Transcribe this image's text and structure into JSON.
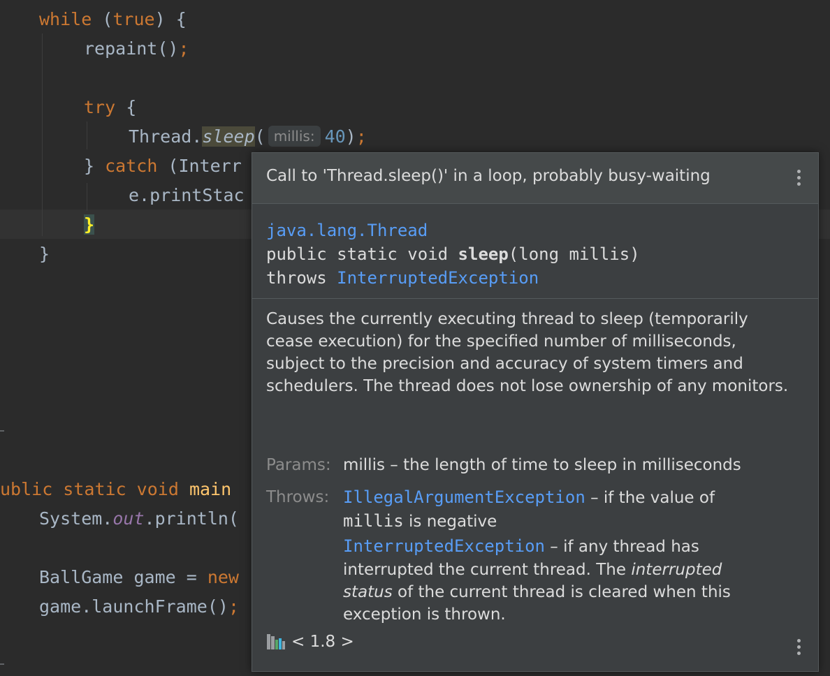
{
  "editor": {
    "lines": {
      "while_kw": "while",
      "while_rest": " (",
      "true_kw": "true",
      "while_tail": ") {",
      "repaint": "repaint()",
      "repaint_semi": ";",
      "try_kw": "try",
      "try_tail": " {",
      "thread_prefix": "Thread.",
      "sleep_method": "sleep",
      "sleep_open": "(",
      "param_hint": "millis:",
      "sleep_arg": "40",
      "sleep_close": ")",
      "sleep_semi": ";",
      "catch_open": "} ",
      "catch_kw": "catch",
      "catch_tail": " (Interr",
      "print_stack": "e.printStac",
      "inner_close_brace": "}",
      "outer_close_brace": "}",
      "main_prefix": "ublic static void ",
      "main_name": "main",
      "sysout_prefix": "System.",
      "sysout_field": "out",
      "sysout_tail": ".println(",
      "ballgame_decl": "BallGame game = ",
      "new_kw": "new",
      "launch_call": "game.launchFrame()",
      "launch_semi": ";"
    }
  },
  "popup": {
    "title": "Call to 'Thread.sleep()' in a loop, probably busy-waiting",
    "signature": {
      "class_path": "java.lang.Thread",
      "decl_prefix": "public static void ",
      "method_name": "sleep",
      "decl_suffix": "(long millis)",
      "throws_kw": "throws ",
      "throws_type": "InterruptedException"
    },
    "description": "Causes the currently executing thread to sleep (temporarily cease execution) for the specified number of milliseconds, subject to the precision and accuracy of system timers and schedulers. The thread does not lose ownership of any monitors.",
    "params_label": "Params:",
    "params_text": "millis – the length of time to sleep in milliseconds",
    "throws_label": "Throws:",
    "throws": [
      {
        "type": "IllegalArgumentException",
        "line1": " – if the value of",
        "code": "millis",
        "line2": " is negative"
      },
      {
        "type": "InterruptedException",
        "line1": " – if any thread has",
        "line2_pre": "interrupted the current thread. The ",
        "italic1": "interrupted",
        "italic2": "status",
        "line3": " of the current thread is cleared when this",
        "line4": "exception is thrown."
      }
    ],
    "footer_label": "< 1.8 >"
  },
  "colors": {
    "background": "#2b2b2b",
    "keyword": "#cc7832",
    "number": "#6897bb",
    "link": "#589df6",
    "popup_bg": "#3c3f41"
  }
}
